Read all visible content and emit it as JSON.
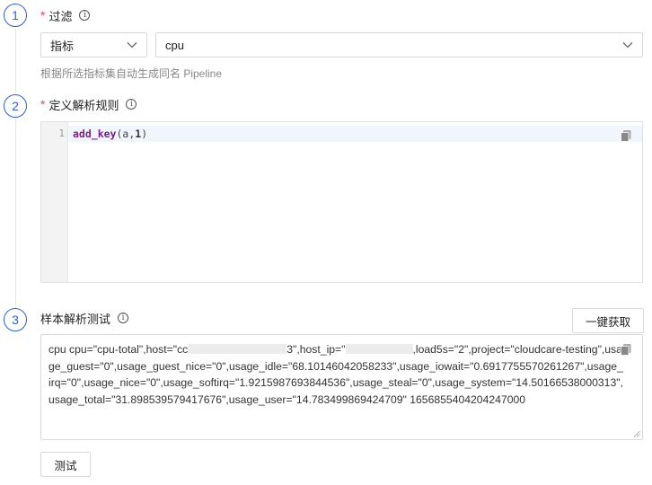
{
  "steps": [
    {
      "number": "1",
      "title": "过滤",
      "required": "*"
    },
    {
      "number": "2",
      "title": "定义解析规则",
      "required": "*"
    },
    {
      "number": "3",
      "title": "样本解析测试"
    }
  ],
  "filter": {
    "type_select": {
      "value": "指标"
    },
    "metric_select": {
      "value": "cpu"
    },
    "hint": "根据所选指标集自动生成同名 Pipeline"
  },
  "editor": {
    "line_number": "1",
    "code": {
      "fn": "add_key",
      "open": "(",
      "arg1": "a",
      "comma": ",",
      "arg2": "1",
      "close": ")"
    }
  },
  "sample": {
    "fetch_button": "一键获取",
    "test_button": "测试",
    "text_part1": "cpu cpu=\"cpu-total\",host=\"cc",
    "text_part2": "3\",host_ip=\"",
    "text_part3": ",load5s=\"2\",project=\"cloudcare-testing\",usage_guest=\"0\",usage_guest_nice=\"0\",usage_idle=\"68.10146042058233\",usage_iowait=\"0.6917755570261267\",usage_irq=\"0\",usage_nice=\"0\",usage_softirq=\"1.9215987693844536\",usage_steal=\"0\",usage_system=\"14.50166538000313\",usage_total=\"31.898539579417676\",usage_user=\"14.783499869424709\" 1656855404204247000"
  },
  "icons": {
    "info": "info-circle-icon",
    "chevron": "chevron-down-icon",
    "copy": "copy-icon",
    "resize": "resize-handle-icon"
  },
  "colors": {
    "accent": "#2f61cc",
    "required": "#e8454c"
  }
}
